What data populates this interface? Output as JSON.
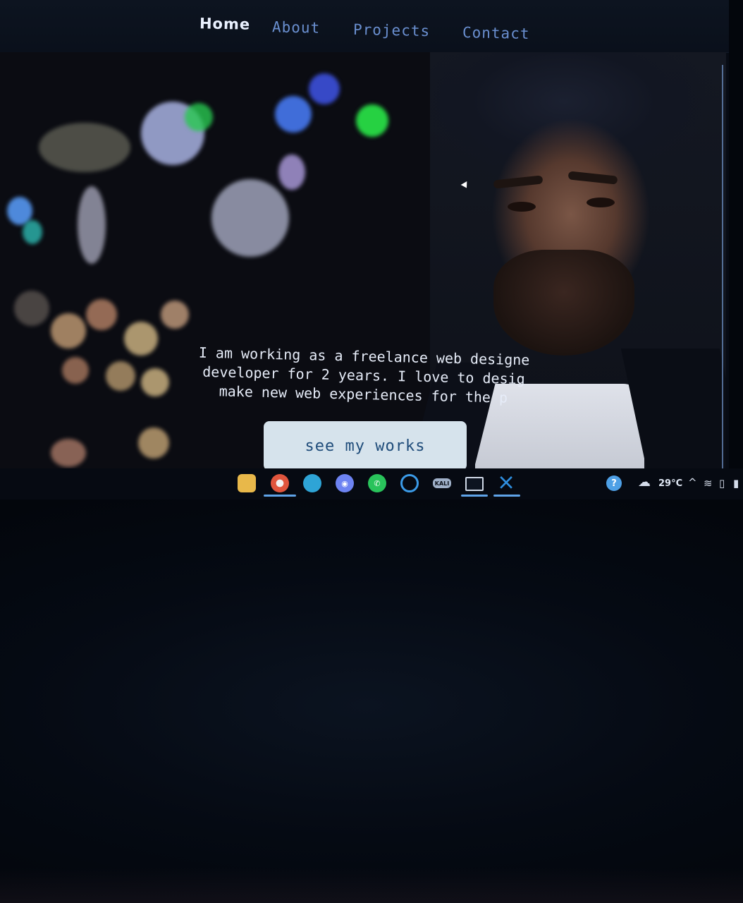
{
  "nav": {
    "items": [
      {
        "label": "Home",
        "active": true
      },
      {
        "label": "About",
        "active": false
      },
      {
        "label": "Projects",
        "active": false
      },
      {
        "label": "Contact",
        "active": false
      }
    ]
  },
  "hero": {
    "intro_lines": [
      "I am working as a freelance web designe",
      "developer for 2 years. I love to desig",
      "make new web experiences for the p"
    ],
    "cta_label": "see my works"
  },
  "taskbar": {
    "icons": [
      {
        "name": "file-explorer-icon",
        "color": "#e8b84a",
        "active": false
      },
      {
        "name": "chrome-icon",
        "color": "#e0553d",
        "active": true
      },
      {
        "name": "edge-icon",
        "color": "#2ea4d6",
        "active": false
      },
      {
        "name": "discord-icon",
        "color": "#6d83f2",
        "active": false
      },
      {
        "name": "whatsapp-icon",
        "color": "#29c35b",
        "active": false
      },
      {
        "name": "cortana-icon",
        "color": "#3b9be8",
        "active": false
      },
      {
        "name": "kali-icon",
        "label": "KALI",
        "color": "#9fb0c8",
        "active": false
      },
      {
        "name": "terminal-icon",
        "color": "#cfd8e6",
        "active": true
      },
      {
        "name": "vscode-icon",
        "color": "#2f8fe0",
        "active": true
      }
    ],
    "tray": {
      "temperature": "29°C"
    }
  },
  "colors": {
    "nav_active": "#eaf1ff",
    "nav_link": "#6a8fd0",
    "cta_bg": "#d6e3ec",
    "cta_text": "#1f4c7a"
  }
}
